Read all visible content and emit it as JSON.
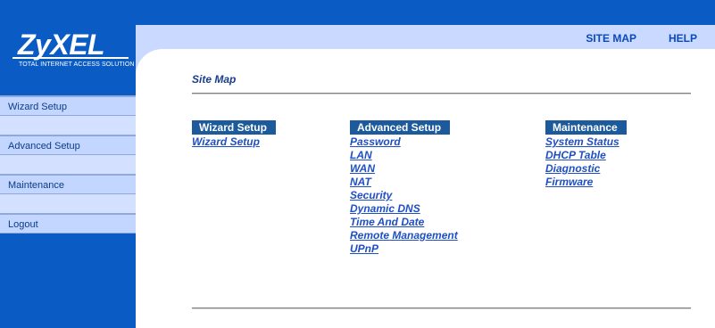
{
  "logo": {
    "brand": "ZyXEL",
    "tagline": "Total Internet Access Solution"
  },
  "header": {
    "links": [
      "SITE MAP",
      "HELP"
    ]
  },
  "sidebar": {
    "items": [
      "Wizard Setup",
      "Advanced Setup",
      "Maintenance",
      "Logout"
    ]
  },
  "main": {
    "title": "Site Map",
    "columns": [
      {
        "heading": "Wizard Setup",
        "links": [
          "Wizard Setup"
        ]
      },
      {
        "heading": "Advanced Setup",
        "links": [
          "Password",
          "LAN",
          "WAN",
          "NAT",
          "Security",
          "Dynamic DNS",
          "Time And Date",
          "Remote Management",
          "UPnP"
        ]
      },
      {
        "heading": "Maintenance",
        "links": [
          "System Status",
          "DHCP Table",
          "Diagnostic",
          "Firmware"
        ]
      }
    ]
  },
  "colors": {
    "brand_blue": "#0a5cc4",
    "menu_bg": "#c3d6ff",
    "heading_bg": "#1c5a9c",
    "link": "#1f4fc4"
  }
}
